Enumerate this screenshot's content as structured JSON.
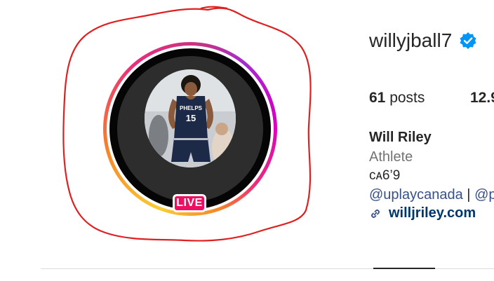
{
  "profile": {
    "username": "willyjball7",
    "verified_icon": "verified-badge-icon",
    "full_name": "Will Riley",
    "category": "Athlete",
    "bio_line": "ᴄᴀ6’9",
    "mention_1": "@uplaycanada",
    "separator": "|",
    "mention_2_partial": "@p",
    "link_icon": "link-icon",
    "external_link": "willjriley.com"
  },
  "stats": {
    "posts_count": "61",
    "posts_label": "posts",
    "followers_partial": "12.9"
  },
  "avatar": {
    "live_label": "LIVE",
    "jersey_team": "PHELPS",
    "jersey_number": "15"
  },
  "colors": {
    "live_badge": "#ee0f63",
    "verified_blue": "#0095f6",
    "annotation_red": "#e02020",
    "link_dark_blue": "#00376b",
    "mention_blue": "#385185"
  }
}
